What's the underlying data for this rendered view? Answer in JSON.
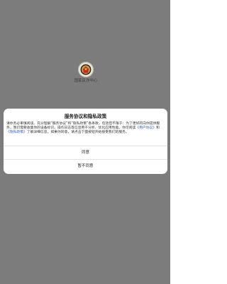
{
  "app": {
    "name": "国家反诈中心"
  },
  "dialog": {
    "title": "服务协议和隐私政策",
    "body_text_1": "请你务必审慎阅读、充分理解“服务协议”和“隐私政策”各条款，包括但不限于：为了更好的向你提供服务，我们需要收集你的设备标识、操作日志等信息用于分析、优化应用性能。你可阅读",
    "user_agreement_link": "《用户协议》",
    "conjunction": "和",
    "privacy_policy_link": "《隐私政策》",
    "body_text_2": "了解详细信息。如果你同意，请点击下面按钮开始接受我们的服务。",
    "agree_label": "同意",
    "decline_label": "暂不同意"
  },
  "colors": {
    "backdrop": "#7c7c7c",
    "link": "#2c5be0",
    "dialog_bg": "#ffffff"
  }
}
